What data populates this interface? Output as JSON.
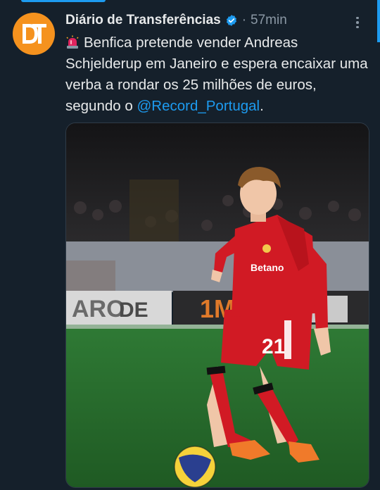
{
  "tweet": {
    "author_name": "Diário de Transferências",
    "separator": "·",
    "time": "57min",
    "avatar_text": "DT",
    "text_before": "Benfica pretende vender Andreas Schjelderup em Janeiro e espera encaixar uma verba a rondar os 25 milhões de euros, segundo o ",
    "mention": "@Record_Portugal",
    "text_after": ".",
    "emoji": "rotating-light",
    "accent_color": "#1d9bf0",
    "avatar_color": "#f5921e",
    "background": "#15202b"
  },
  "photo": {
    "jersey_number": "21",
    "sponsor": "Betano"
  }
}
